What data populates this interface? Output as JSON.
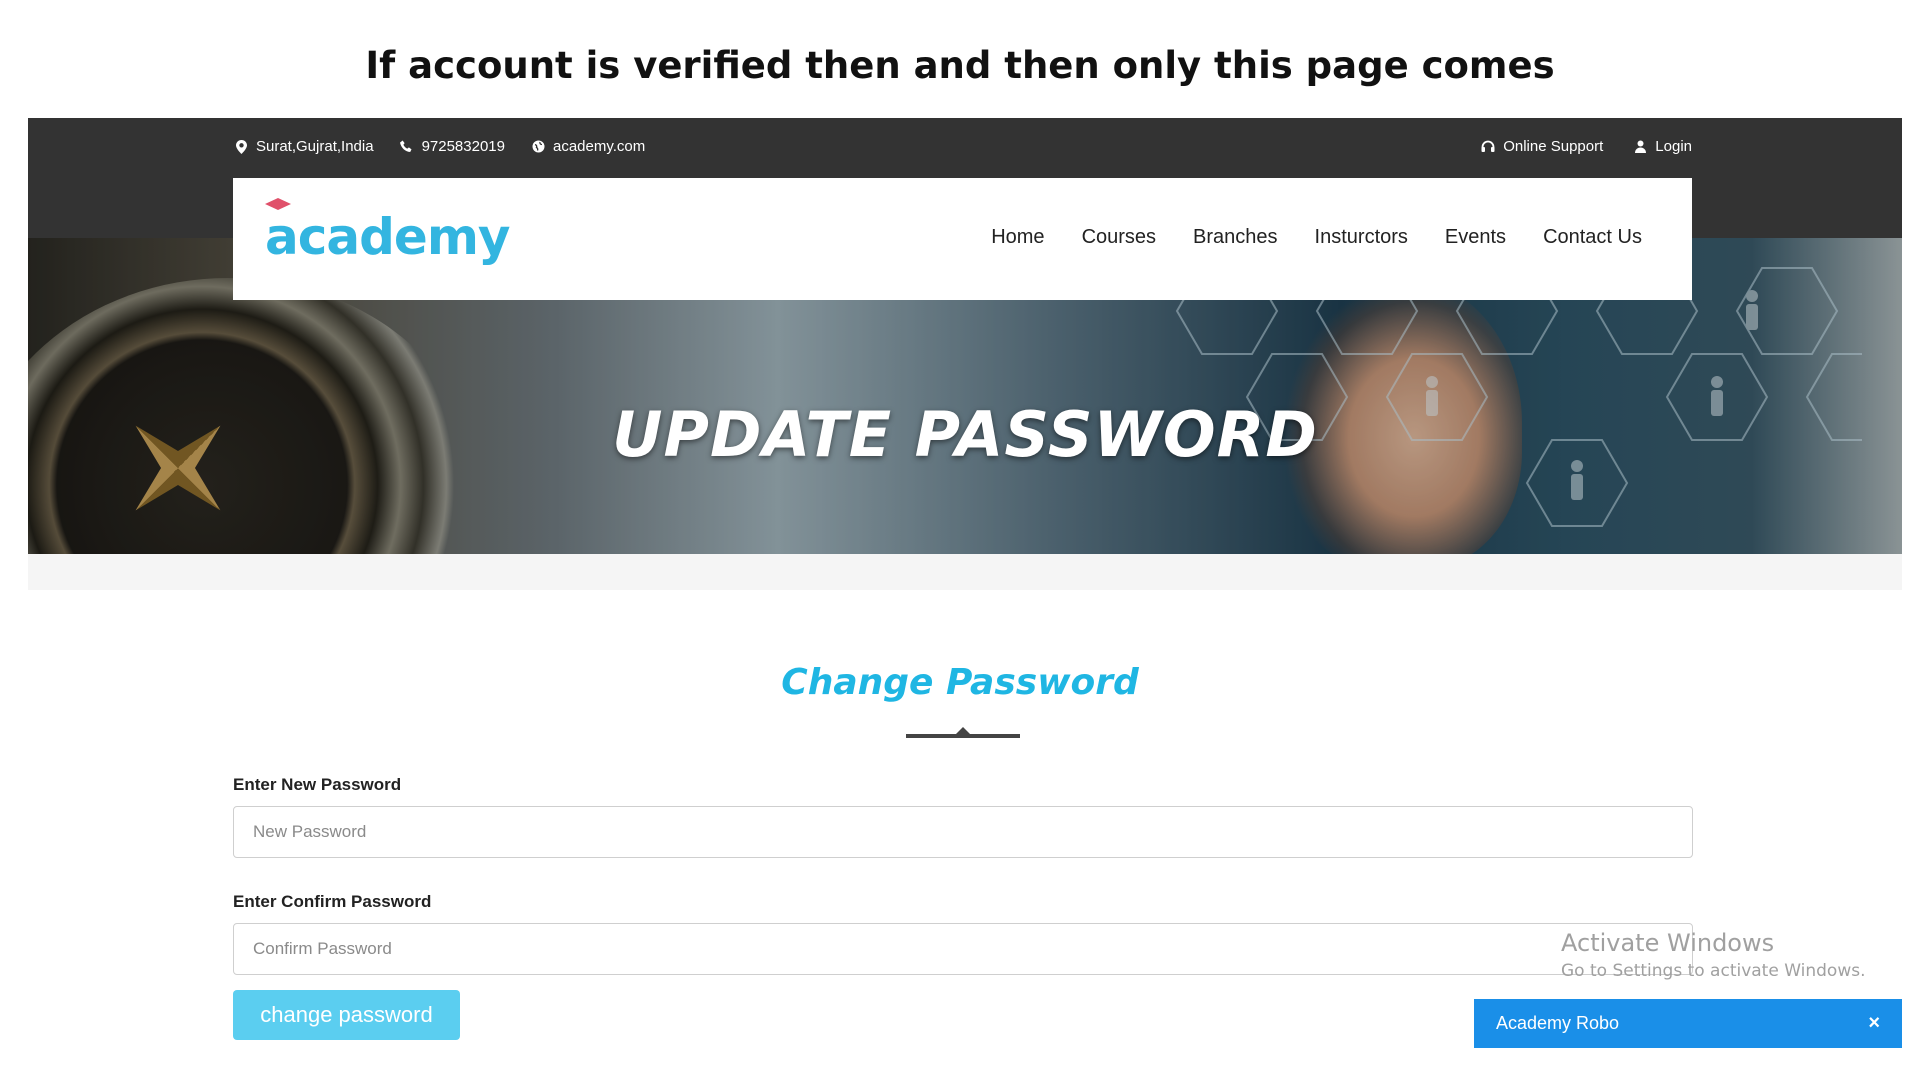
{
  "caption": "If account  is verified then and then only this page comes",
  "topbar": {
    "location": "Surat,Gujrat,India",
    "phone": "9725832019",
    "website": "academy.com",
    "online_support": "Online Support",
    "login": "Login"
  },
  "header": {
    "logo_text": "academy",
    "nav": [
      "Home",
      "Courses",
      "Branches",
      "Insturctors",
      "Events",
      "Contact Us"
    ]
  },
  "banner": {
    "title": "UPDATE PASSWORD"
  },
  "section": {
    "title": "Change Password"
  },
  "form": {
    "new_password_label": "Enter New Password",
    "new_password_placeholder": "New Password",
    "confirm_password_label": "Enter Confirm Password",
    "confirm_password_placeholder": "Confirm Password",
    "submit_label": "change password"
  },
  "watermark": {
    "title": "Activate Windows",
    "subtitle": "Go to Settings to activate Windows."
  },
  "chat": {
    "title": "Academy Robo",
    "close_icon": "×"
  },
  "colors": {
    "accent": "#1fb6e3",
    "button": "#5bcef0",
    "topbar": "#333333",
    "chat": "#1a8fe8",
    "logo_accent": "#e0506a"
  }
}
